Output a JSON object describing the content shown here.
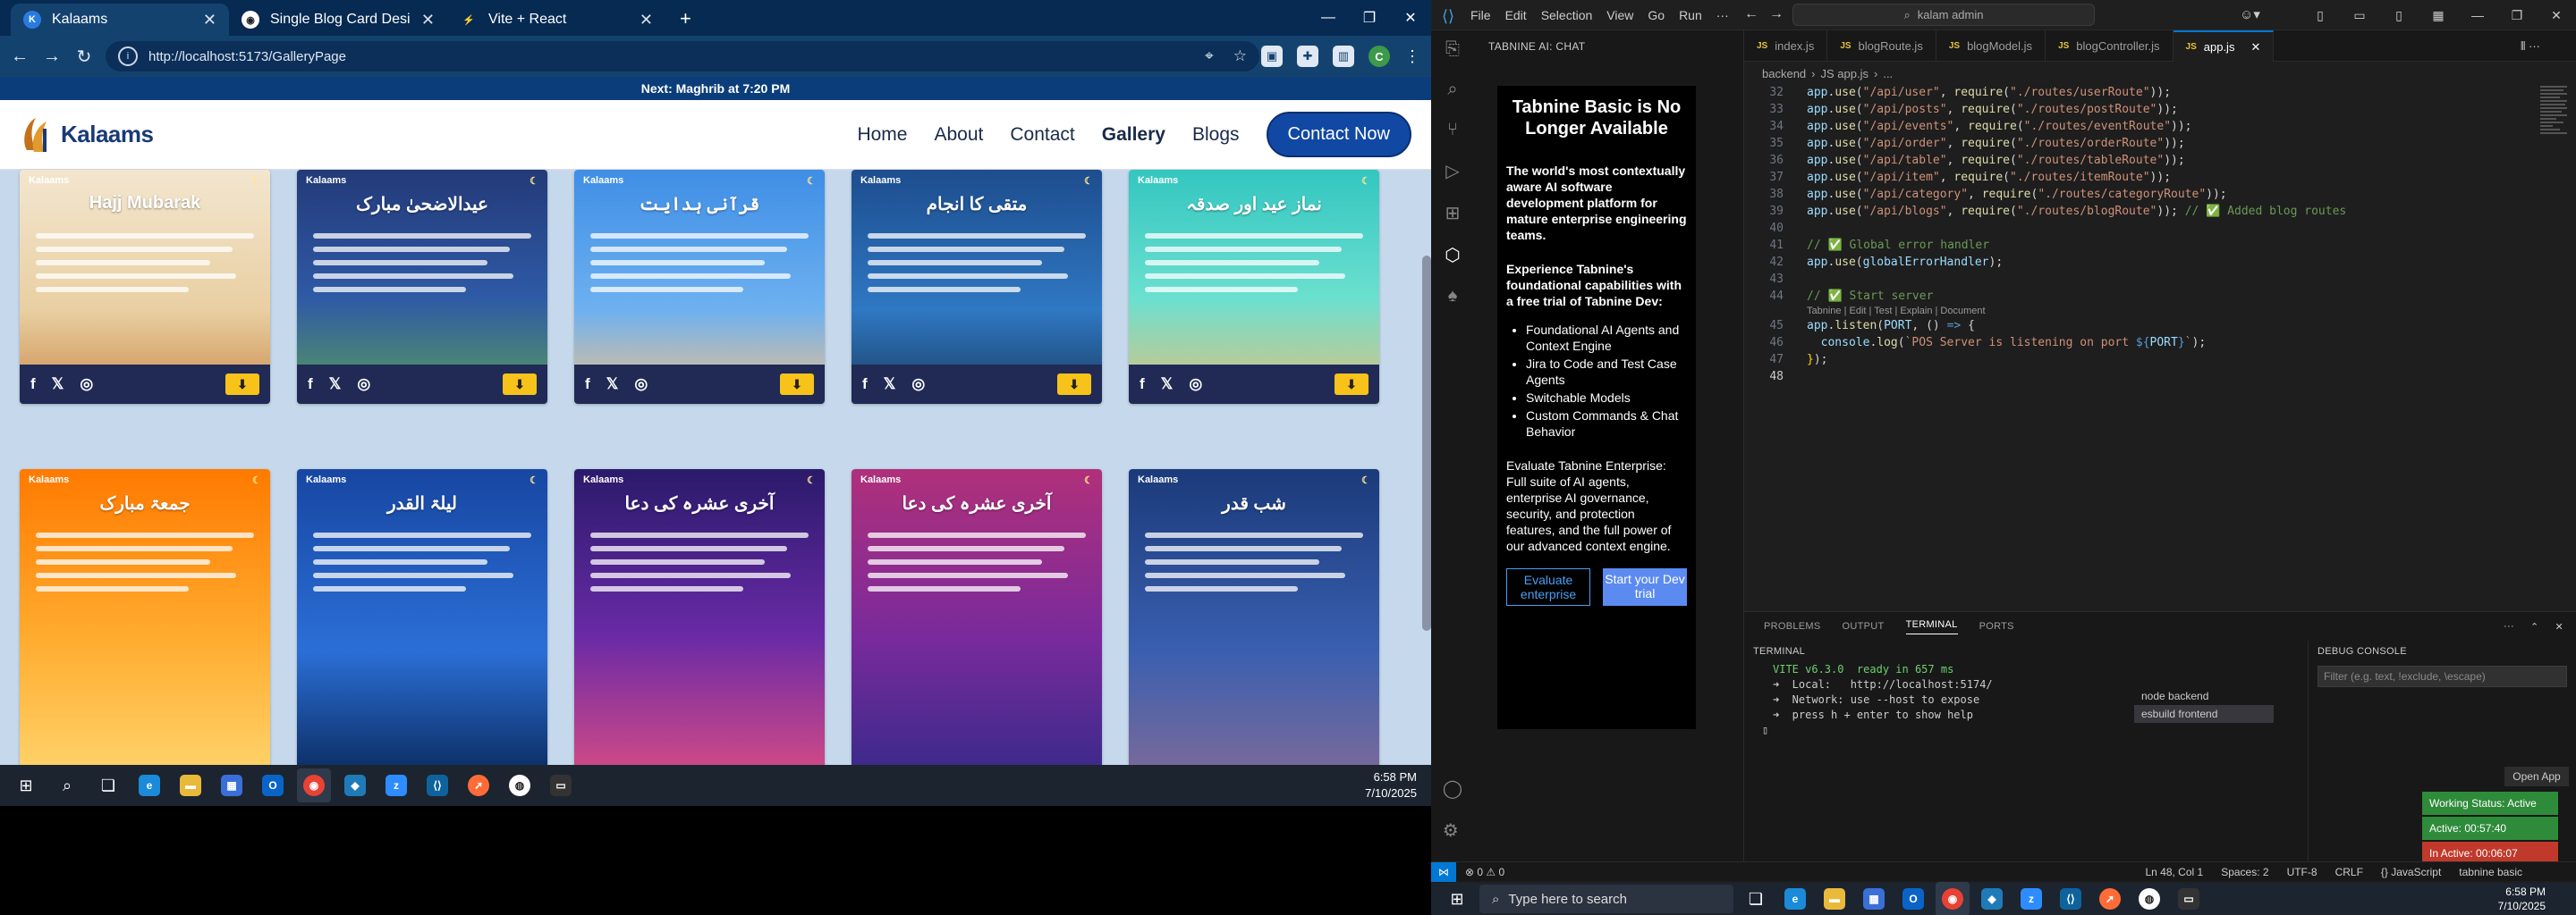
{
  "chrome": {
    "tabs": [
      {
        "title": "Kalaams",
        "favicon": "K",
        "color": "#2a7be0"
      },
      {
        "title": "Single Blog Card Design",
        "favicon": "◉",
        "color": "#2b2b2b"
      },
      {
        "title": "Vite + React",
        "favicon": "⚡",
        "color": "#8a5cf6"
      }
    ],
    "url": "http://localhost:5173/GalleryPage",
    "profile_initial": "C"
  },
  "site": {
    "announcement": "Next: Maghrib at 7:20 PM",
    "logo_text": "Kalaams",
    "nav": [
      "Home",
      "About",
      "Contact",
      "Gallery",
      "Blogs"
    ],
    "contact_button": "Contact Now"
  },
  "gallery": [
    {
      "title": "Hajj Mubarak",
      "bg": "linear-gradient(180deg,#f3e6cf 0%,#e9cfa2 60%,#c98a4a 100%)"
    },
    {
      "title": "عیدالاضحیٰ مبارک",
      "bg": "linear-gradient(180deg,#233a78 0%,#2f5aa6 55%,#5a9d59 100%)"
    },
    {
      "title": "قرآنی ہدایت",
      "bg": "linear-gradient(180deg,#3f8ee6 0%,#6db1f0 60%,#f2c28a 100%)"
    },
    {
      "title": "متقی کا انجام",
      "bg": "linear-gradient(180deg,#1d4d8e 0%,#2f78c3 60%,#1a3c5f 100%)"
    },
    {
      "title": "نماز عید اور صدقہ",
      "bg": "linear-gradient(180deg,#33c6c0 0%,#6be0d0 55%,#e3c07a 100%)"
    },
    {
      "title": "جمعۃ مبارک",
      "bg": "linear-gradient(180deg,#ff7a00 0%,#ffab2e 55%,#ffd36b 100%)"
    },
    {
      "title": "لیلۃ القدر",
      "bg": "linear-gradient(180deg,#1746a2 0%,#2b6fd6 60%,#0c2d63 100%)"
    },
    {
      "title": "آخری عشرہ کی دعا",
      "bg": "linear-gradient(180deg,#2a1a6b 0%,#6a2aa6 55%,#d24a86 100%)"
    },
    {
      "title": "آخری عشرہ کی دعا",
      "bg": "linear-gradient(180deg,#b0307a 0%,#7a2a9c 55%,#3a2a8a 100%)"
    },
    {
      "title": "شب قدر",
      "bg": "linear-gradient(180deg,#1b3a7a 0%,#3a5fb0 60%,#7a6a9a 100%)"
    }
  ],
  "card_social": {
    "facebook": "f",
    "x": "𝕏",
    "instagram": "◎",
    "download": "⬇"
  },
  "left_taskbar": {
    "time": "6:58 PM",
    "date": "7/10/2025"
  },
  "vscode": {
    "menu": [
      "File",
      "Edit",
      "Selection",
      "View",
      "Go",
      "Run",
      "···"
    ],
    "search": "kalam admin",
    "chat_header": "TABNINE AI: CHAT",
    "tabnine": {
      "heading": "Tabnine Basic is No Longer Available",
      "p1": "The world's most contextually aware AI software development platform for mature enterprise engineering teams.",
      "p2": "Experience Tabnine's foundational capabilities with a free trial of Tabnine Dev:",
      "features": [
        "Foundational AI Agents and Context Engine",
        "Jira to Code and Test Case Agents",
        "Switchable Models",
        "Custom Commands & Chat Behavior"
      ],
      "p3": "Evaluate Tabnine Enterprise: Full suite of AI agents, enterprise AI governance, security, and protection features, and the full power of our advanced context engine.",
      "btn_eval": "Evaluate enterprise",
      "btn_trial": "Start your Dev trial"
    },
    "tabs": [
      "index.js",
      "blogRoute.js",
      "blogModel.js",
      "blogController.js",
      "app.js"
    ],
    "breadcrumb": [
      "backend",
      "JS app.js",
      "..."
    ],
    "code_lens": "Tabnine | Edit | Test | Explain | Document",
    "panel_tabs": [
      "PROBLEMS",
      "OUTPUT",
      "TERMINAL",
      "PORTS"
    ],
    "terminal_header": "TERMINAL",
    "terminal_lines": [
      "VITE v6.3.0  ready in 657 ms",
      "",
      "➜  Local:   http://localhost:5174/",
      "➜  Network: use --host to expose",
      "➜  press h + enter to show help"
    ],
    "terminal_list": [
      "node backend",
      "esbuild frontend"
    ],
    "debug_header": "DEBUG CONSOLE",
    "debug_placeholder": "Filter (e.g. text, !exclude, \\escape)",
    "status": {
      "errors": "⊗ 0 ⚠ 0",
      "pos": "Ln 48, Col 1",
      "spaces": "Spaces: 2",
      "enc": "UTF-8",
      "eol": "CRLF",
      "lang": "{} JavaScript",
      "tabnine": "tabnine basic"
    },
    "open_app": "Open App",
    "working": [
      "Working Status: Active",
      "Active: 00:57:40",
      "In Active: 00:06:07"
    ]
  },
  "right_taskbar": {
    "search": "Type here to search",
    "time": "6:58 PM",
    "date": "7/10/2025"
  }
}
